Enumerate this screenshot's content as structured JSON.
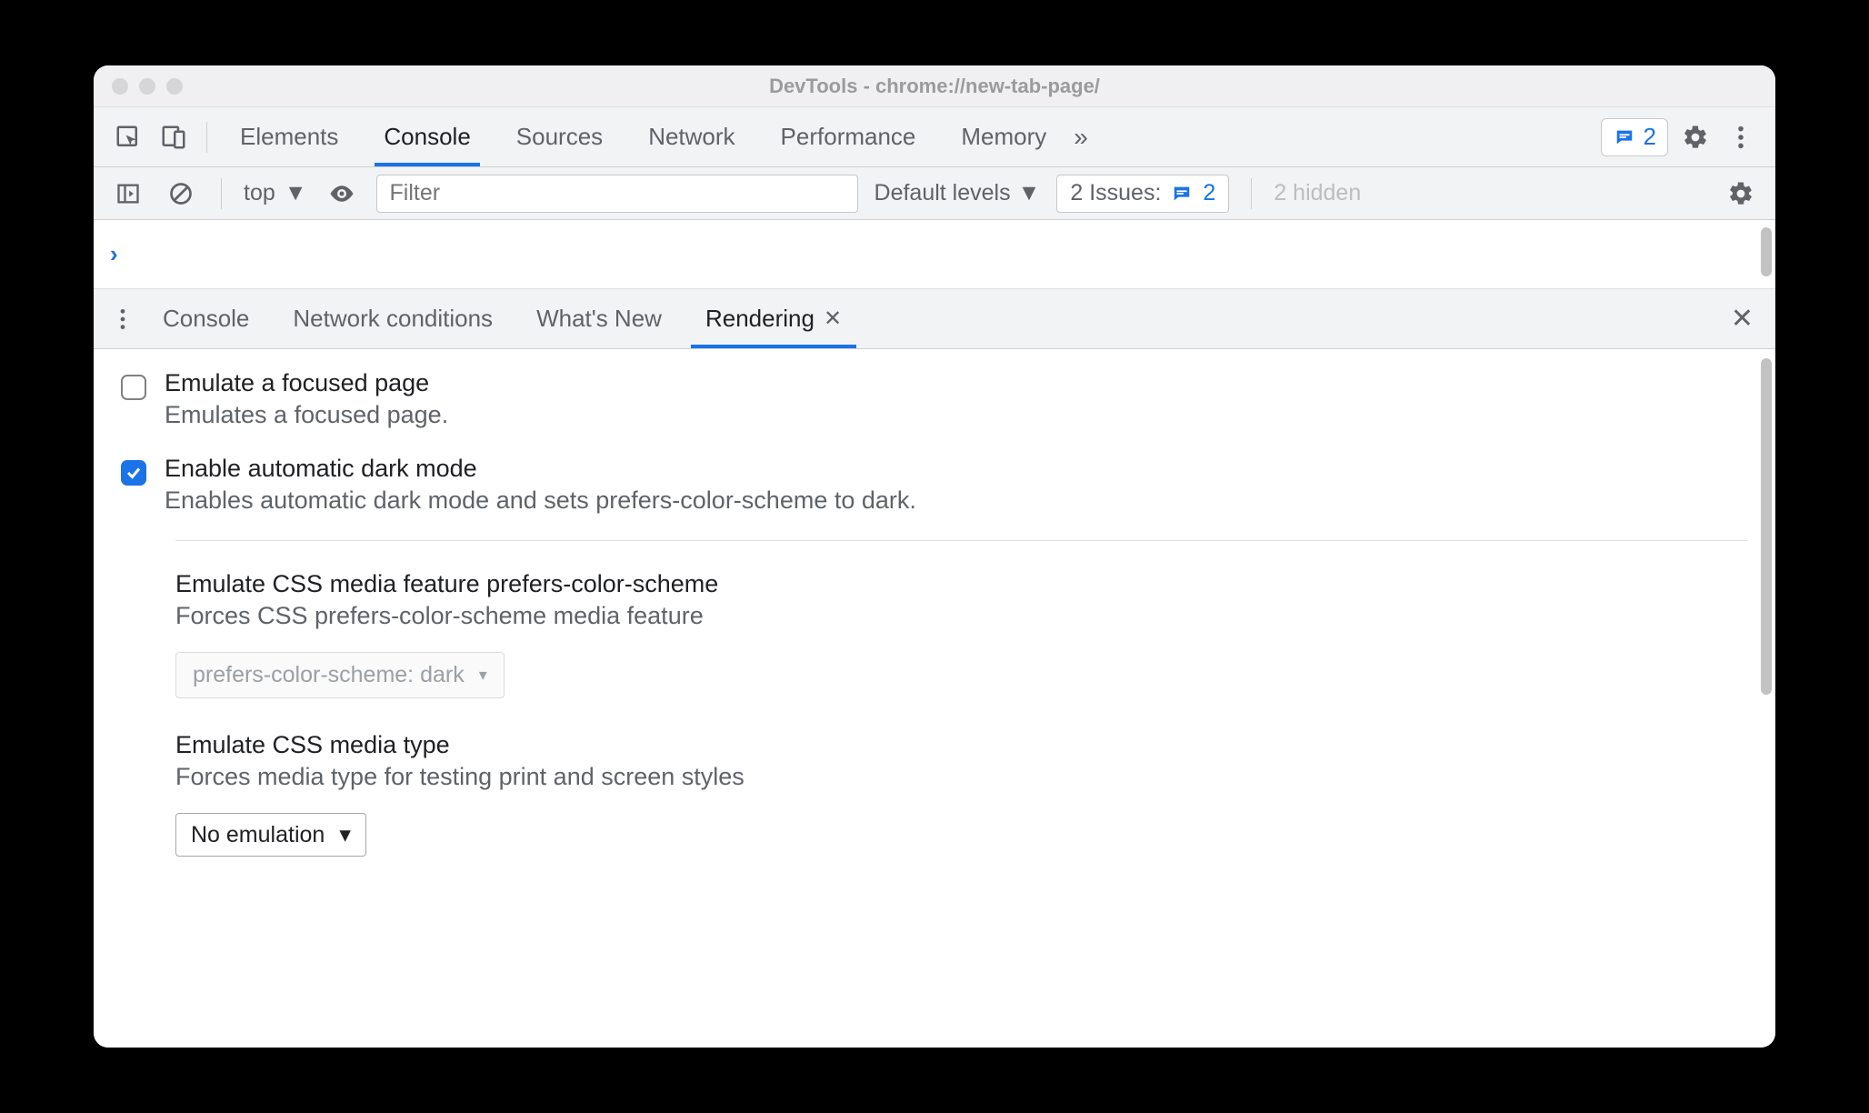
{
  "window": {
    "title": "DevTools - chrome://new-tab-page/"
  },
  "mainTabs": {
    "elements": "Elements",
    "console": "Console",
    "sources": "Sources",
    "network": "Network",
    "performance": "Performance",
    "memory": "Memory",
    "issuesCount": "2"
  },
  "consoleBar": {
    "context": "top",
    "filterPlaceholder": "Filter",
    "levels": "Default levels",
    "issuesLabel": "2 Issues:",
    "issuesNum": "2",
    "hidden": "2 hidden"
  },
  "drawerTabs": {
    "console": "Console",
    "netcond": "Network conditions",
    "whatsnew": "What's New",
    "rendering": "Rendering"
  },
  "rendering": {
    "focusTitle": "Emulate a focused page",
    "focusDesc": "Emulates a focused page.",
    "darkTitle": "Enable automatic dark mode",
    "darkDesc": "Enables automatic dark mode and sets prefers-color-scheme to dark.",
    "pcsTitle": "Emulate CSS media feature prefers-color-scheme",
    "pcsDesc": "Forces CSS prefers-color-scheme media feature",
    "pcsValue": "prefers-color-scheme: dark",
    "mediaTitle": "Emulate CSS media type",
    "mediaDesc": "Forces media type for testing print and screen styles",
    "mediaValue": "No emulation"
  }
}
